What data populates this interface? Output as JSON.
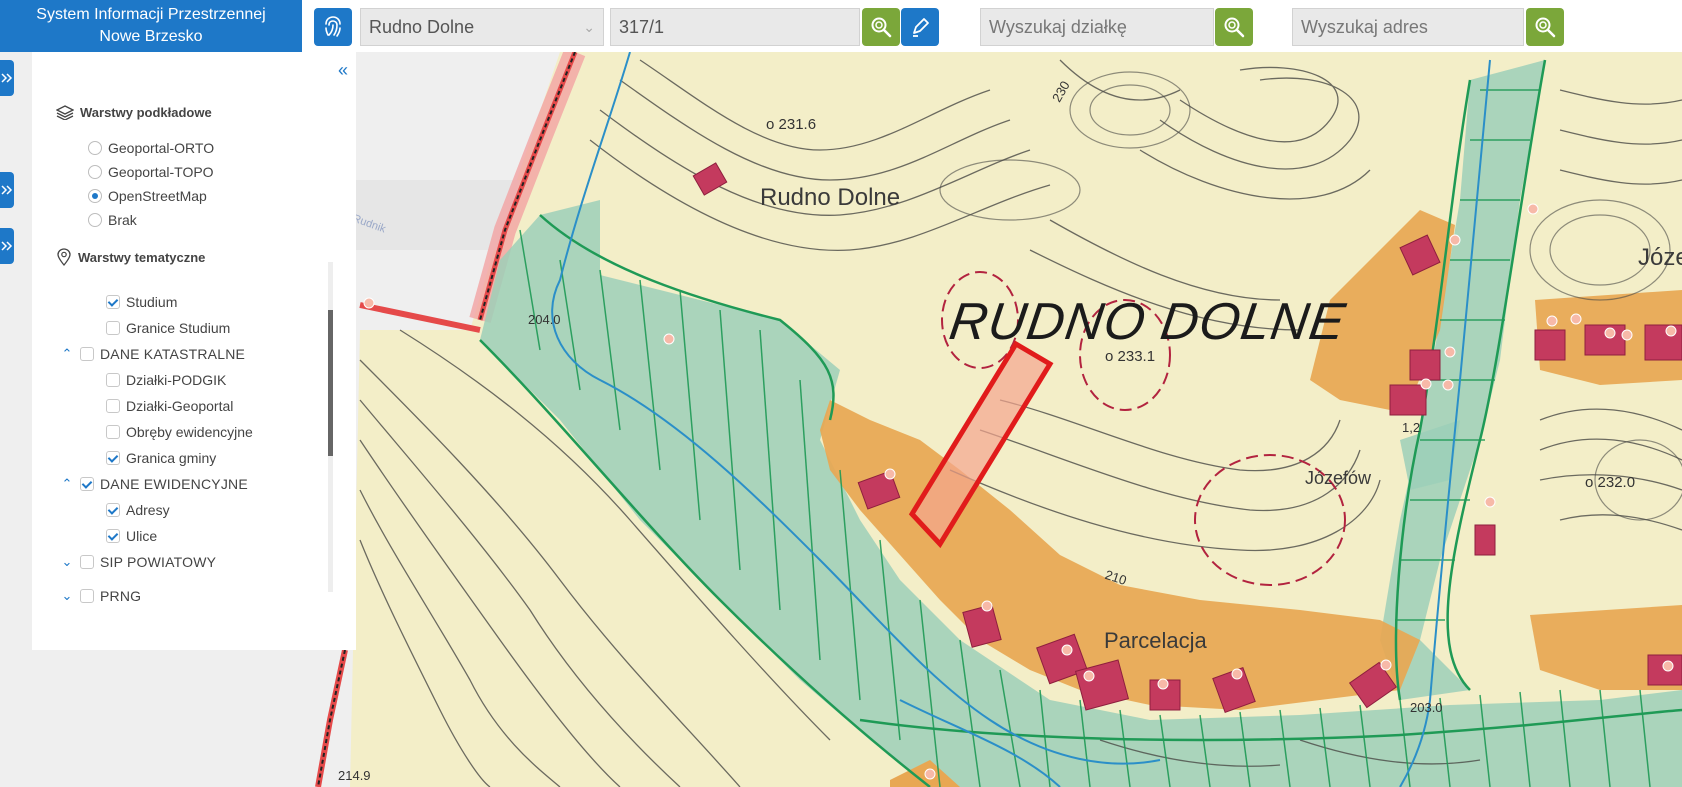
{
  "header": {
    "title_line1": "System Informacji Przestrzennej",
    "title_line2": "Nowe Brzesko"
  },
  "toolbar": {
    "locate_icon": "fingerprint-icon",
    "precinct_value": "Rudno Dolne",
    "parcel_value": "317/1",
    "search_icon": "magnifier-icon",
    "edit_icon": "pen-icon",
    "parcel_search_placeholder": "Wyszukaj działkę",
    "address_search_placeholder": "Wyszukaj adres"
  },
  "panel": {
    "base_layers_title": "Warstwy podkładowe",
    "base_layers": [
      {
        "label": "Geoportal-ORTO",
        "selected": false
      },
      {
        "label": "Geoportal-TOPO",
        "selected": false
      },
      {
        "label": "OpenStreetMap",
        "selected": true
      },
      {
        "label": "Brak",
        "selected": false
      }
    ],
    "thematic_title": "Warstwy tematyczne",
    "thematic": {
      "studium": "Studium",
      "granice_studium": "Granice Studium",
      "dane_katastralne": "DANE KATASTRALNE",
      "dzialki_podgik": "Działki-PODGIK",
      "dzialki_geoportal": "Działki-Geoportal",
      "obreby": "Obręby ewidencyjne",
      "granica_gminy": "Granica gminy",
      "dane_ewidencyjne": "DANE EWIDENCYJNE",
      "adresy": "Adresy",
      "ulice": "Ulice",
      "sip_powiatowy": "SIP POWIATOWY",
      "prng": "PRNG"
    }
  },
  "map": {
    "labels": {
      "village": "RUDNO DOLNE",
      "village_small": "Rudno Dolne",
      "parcelacja": "Parcelacja",
      "jozefow": "Józefów",
      "jozef_cut": "Józe",
      "h2316": "o 231.6",
      "h2331": "o 233.1",
      "h2040": "204.0",
      "h2320": "o 232.0",
      "h2030": "203.0",
      "h2149": "214.9",
      "c210": "210",
      "c230": "230",
      "c12": "1,2",
      "street": "Rudnik"
    },
    "colors": {
      "paper": "#f3eec8",
      "residential": "#e8a752",
      "meadow": "#9ccfb9",
      "contour": "#4a4a46",
      "stream": "#2b8fc8",
      "parcel_outline": "#e11b1b",
      "building": "#c43a5e",
      "boundary": "#e54a4a"
    }
  }
}
